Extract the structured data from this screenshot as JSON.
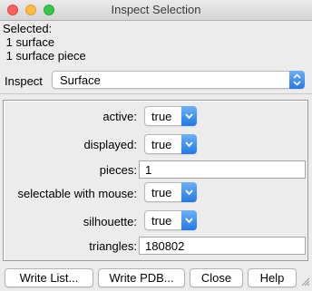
{
  "window": {
    "title": "Inspect Selection"
  },
  "selected": {
    "heading": "Selected:",
    "lines": [
      " 1 surface",
      " 1 surface piece"
    ]
  },
  "inspect": {
    "label": "Inspect",
    "value": "Surface"
  },
  "properties": [
    {
      "label": "active:",
      "value": "true"
    },
    {
      "label": "displayed:",
      "value": "true"
    },
    {
      "label": "pieces:",
      "value": "1"
    },
    {
      "label": "selectable with mouse:",
      "value": "true"
    },
    {
      "label": "silhouette:",
      "value": "true"
    },
    {
      "label": "triangles:",
      "value": "180802"
    }
  ],
  "buttons": {
    "write_list": "Write List...",
    "write_pdb": "Write PDB...",
    "close": "Close",
    "help": "Help"
  },
  "colors": {
    "accent": "#2f86ef"
  }
}
